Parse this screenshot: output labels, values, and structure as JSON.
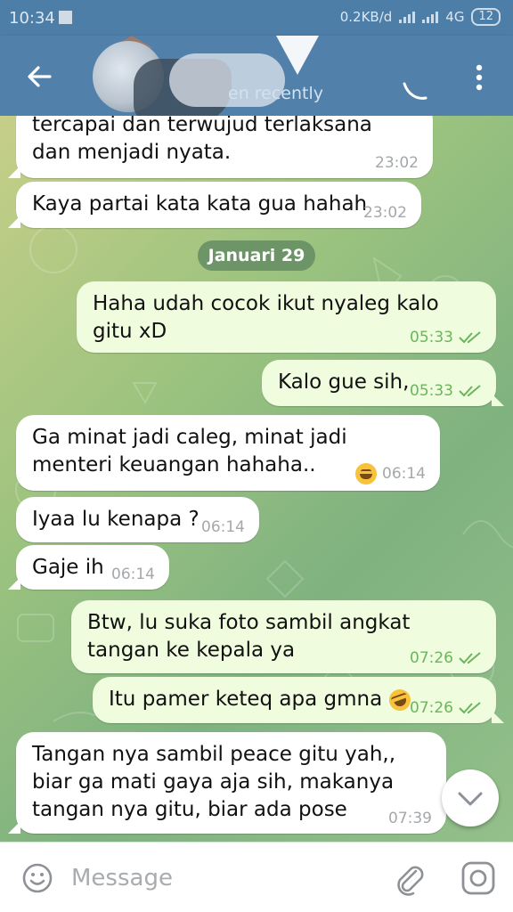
{
  "status_bar": {
    "time": "10:34",
    "speed": "0.2KB/d",
    "network": "4G",
    "battery": "12"
  },
  "header": {
    "subtitle": "en recently",
    "back_icon": "arrow-left-icon",
    "call_icon": "phone-icon",
    "more_icon": "more-vertical-icon"
  },
  "chat": {
    "date_separator": "Januari 29",
    "messages": [
      {
        "text": "tercapai dan terwujud terlaksana dan menjadi nyata.",
        "time": "23:02",
        "direction": "in"
      },
      {
        "text": "Kaya partai kata kata gua hahah",
        "time": "23:02",
        "direction": "in"
      },
      {
        "text": "Haha udah cocok ikut nyaleg kalo gitu xD",
        "time": "05:33",
        "direction": "out",
        "read": true
      },
      {
        "text": "Kalo gue sih,",
        "time": "05:33",
        "direction": "out",
        "read": true
      },
      {
        "text": "Ga minat jadi caleg, minat jadi menteri keuangan hahaha..",
        "time": "06:14",
        "direction": "in",
        "emoji": "smiling-face-icon"
      },
      {
        "text": "Iyaa lu kenapa ?",
        "time": "06:14",
        "direction": "in"
      },
      {
        "text": "Gaje ih",
        "time": "06:14",
        "direction": "in"
      },
      {
        "text": "Btw, lu suka foto sambil angkat tangan ke kepala ya",
        "time": "07:26",
        "direction": "out",
        "read": true
      },
      {
        "text": "Itu pamer keteq apa gmna",
        "time": "07:26",
        "direction": "out",
        "read": true,
        "emoji": "rolling-laughing-icon"
      },
      {
        "text": "Tangan nya sambil peace gitu yah,, biar ga mati gaya aja sih, makanya tangan nya gitu, biar ada pose",
        "time": "07:39",
        "direction": "in"
      }
    ]
  },
  "input_bar": {
    "placeholder": "Message",
    "emoji_icon": "smiley-icon",
    "attach_icon": "paperclip-icon",
    "camera_icon": "instagram-camera-icon"
  },
  "colors": {
    "header": "#5181ab",
    "status_bar": "#4d7ea8",
    "incoming_bubble": "#ffffff",
    "outgoing_bubble": "#effdde",
    "read_check": "#6cb45e",
    "date_chip": "#608860"
  }
}
